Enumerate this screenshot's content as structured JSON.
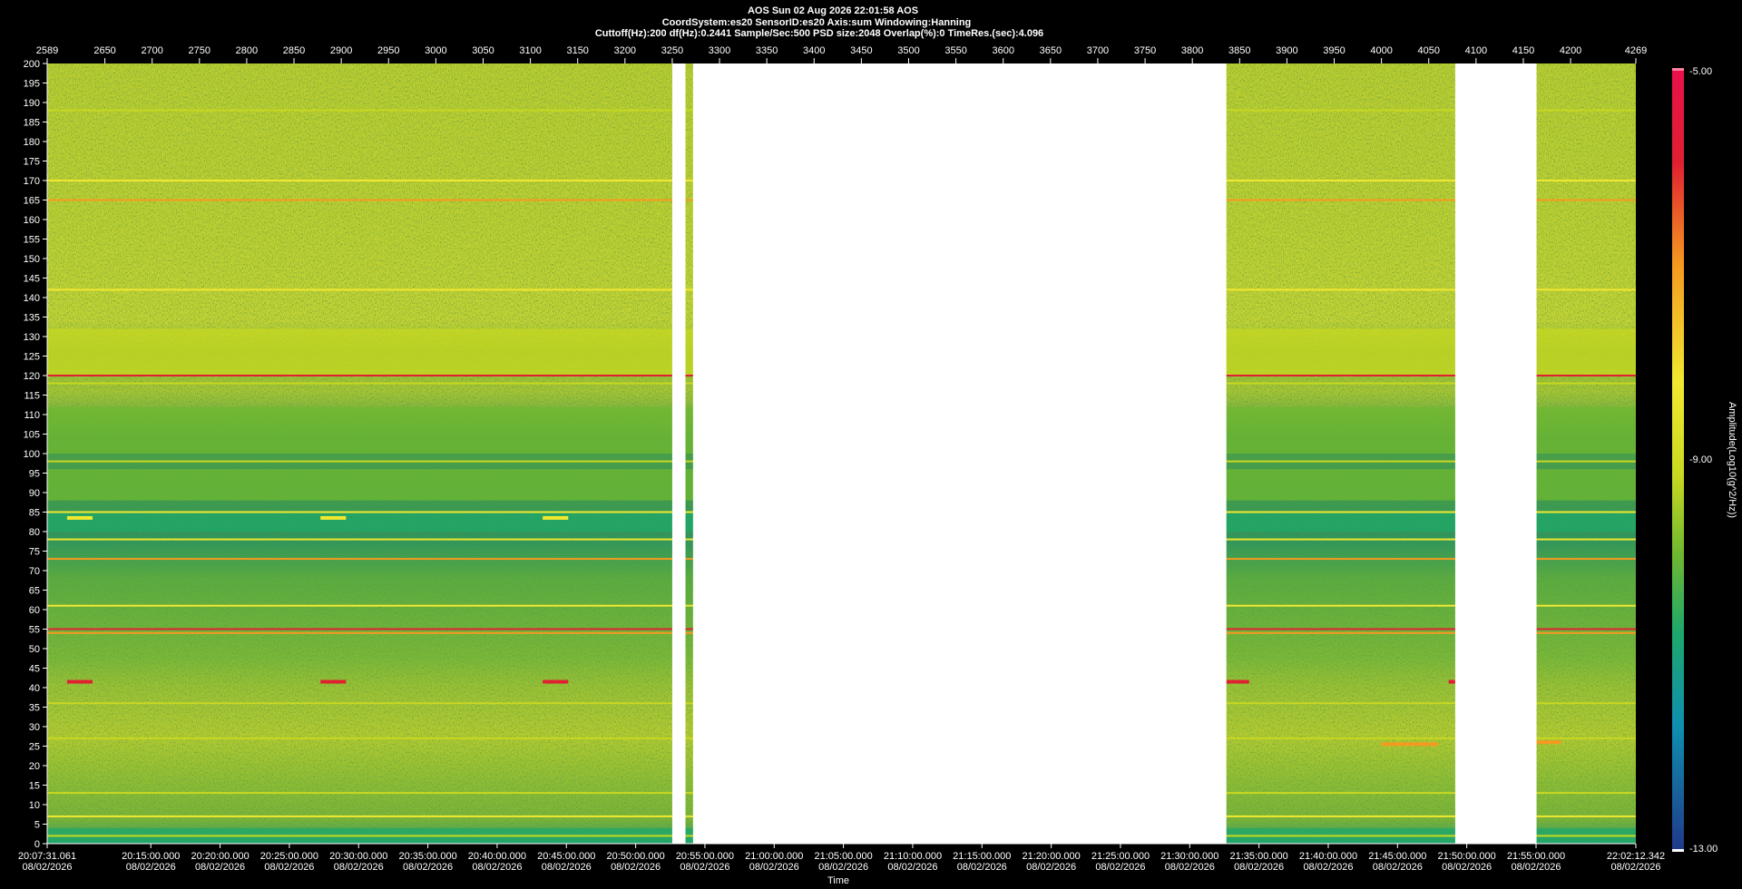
{
  "header": {
    "line1": "AOS  Sun 02 Aug 2026 22:01:58  AOS",
    "line2": "CoordSystem:es20    SensorID:es20    Axis:sum    Windowing:Hanning",
    "line3": "Cuttoff(Hz):200       df(Hz):0.2441       Sample/Sec:500       PSD size:2048       Overlap(%):0       TimeRes.(sec):4.096"
  },
  "colors": {
    "background": "#000000",
    "gap": "#ffffff",
    "colormap": [
      "#1f3a8a",
      "#0f8fb0",
      "#1fa86a",
      "#6fb830",
      "#c8d820",
      "#f2e830",
      "#f59a20",
      "#e02030",
      "#e8104a"
    ]
  },
  "chart_data": {
    "type": "heatmap",
    "title": "AOS  Sun 02 Aug 2026 22:01:58  AOS",
    "xlabel": "Time",
    "ylabel": "",
    "x_range_index": [
      2589,
      4269
    ],
    "top_ticks": [
      "2589",
      "2650",
      "2700",
      "2750",
      "2800",
      "2850",
      "2900",
      "2950",
      "3000",
      "3050",
      "3100",
      "3150",
      "3200",
      "3250",
      "3300",
      "3350",
      "3400",
      "3450",
      "3500",
      "3550",
      "3600",
      "3650",
      "3700",
      "3750",
      "3800",
      "3850",
      "3900",
      "3950",
      "4000",
      "4050",
      "4100",
      "4150",
      "4200",
      "4269"
    ],
    "y_ticks": [
      "200",
      "195",
      "190",
      "185",
      "180",
      "175",
      "170",
      "165",
      "160",
      "155",
      "150",
      "145",
      "140",
      "135",
      "130",
      "125",
      "120",
      "115",
      "110",
      "105",
      "100",
      "95",
      "90",
      "85",
      "80",
      "75",
      "70",
      "65",
      "60",
      "55",
      "50",
      "45",
      "40",
      "35",
      "30",
      "25",
      "20",
      "15",
      "10",
      "5",
      "0"
    ],
    "ylim": [
      0,
      200
    ],
    "time_start": "20:07:31.061",
    "time_end": "22:02:12.342",
    "date": "08/02/2026",
    "time_ticks": [
      "20:07:31.061",
      "20:15:00.000",
      "20:20:00.000",
      "20:25:00.000",
      "20:30:00.000",
      "20:35:00.000",
      "20:40:00.000",
      "20:45:00.000",
      "20:50:00.000",
      "20:55:00.000",
      "21:00:00.000",
      "21:05:00.000",
      "21:10:00.000",
      "21:15:00.000",
      "21:20:00.000",
      "21:25:00.000",
      "21:30:00.000",
      "21:35:00.000",
      "21:40:00.000",
      "21:45:00.000",
      "21:50:00.000",
      "21:55:00.000",
      "22:02:12.342"
    ],
    "data_gaps_index": [
      [
        3250,
        3264
      ],
      [
        3272,
        3836
      ],
      [
        4078,
        4164
      ]
    ],
    "colorbar": {
      "label": "Amplitude(Log10(g^2/Hz))",
      "ticks": [
        "-5.00",
        "-9.00",
        "-13.00"
      ],
      "range": [
        -13,
        -5
      ]
    },
    "horizontal_lines_hz": [
      {
        "hz": 188,
        "level": -8.6
      },
      {
        "hz": 170,
        "level": -8.4
      },
      {
        "hz": 165,
        "level": -6.6
      },
      {
        "hz": 142,
        "level": -8.3
      },
      {
        "hz": 120,
        "level": -6.2
      },
      {
        "hz": 118,
        "level": -8.6
      },
      {
        "hz": 98,
        "level": -8.6
      },
      {
        "hz": 85,
        "level": -8.4
      },
      {
        "hz": 78,
        "level": -8.2
      },
      {
        "hz": 73,
        "level": -7.0
      },
      {
        "hz": 61,
        "level": -8.3
      },
      {
        "hz": 55,
        "level": -6.0
      },
      {
        "hz": 54,
        "level": -6.8
      },
      {
        "hz": 36,
        "level": -8.6
      },
      {
        "hz": 27,
        "level": -8.6
      },
      {
        "hz": 13,
        "level": -8.6
      },
      {
        "hz": 7,
        "level": -8.4
      },
      {
        "hz": 2,
        "level": -8.8
      }
    ],
    "bands_hz": [
      {
        "from": 80,
        "to": 85,
        "level": -10.8
      },
      {
        "from": 88,
        "to": 96,
        "level": -10.2
      },
      {
        "from": 100,
        "to": 112,
        "level": -9.8
      },
      {
        "from": 0,
        "to": 4,
        "level": -10.8
      },
      {
        "from": 120,
        "to": 132,
        "level": -9.4
      }
    ],
    "short_segments": [
      {
        "from": 2610,
        "to": 2637,
        "hz": 83.5,
        "level": -8.3
      },
      {
        "from": 2878,
        "to": 2905,
        "hz": 83.5,
        "level": -8.3
      },
      {
        "from": 3113,
        "to": 3140,
        "hz": 83.5,
        "level": -8.3
      },
      {
        "from": 2610,
        "to": 2637,
        "hz": 41.5,
        "level": -5.8
      },
      {
        "from": 2878,
        "to": 2905,
        "hz": 41.5,
        "level": -5.8
      },
      {
        "from": 3113,
        "to": 3140,
        "hz": 41.5,
        "level": -5.8
      },
      {
        "from": 3836,
        "to": 3860,
        "hz": 41.5,
        "level": -5.8
      },
      {
        "from": 4071,
        "to": 4078,
        "hz": 41.5,
        "level": -5.8
      },
      {
        "from": 4000,
        "to": 4060,
        "hz": 25.5,
        "level": -7.2
      },
      {
        "from": 4164,
        "to": 4190,
        "hz": 26,
        "level": -7.4
      }
    ]
  }
}
